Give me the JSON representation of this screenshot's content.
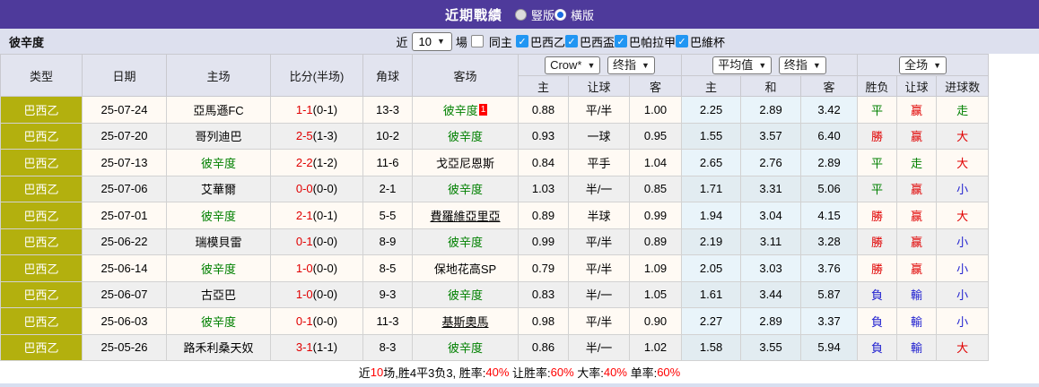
{
  "colors": {
    "accent_purple": "#4e3a9b",
    "league_bg": "#b3b00e",
    "checkbox_blue": "#2196f3",
    "red": "#e00000",
    "green": "#008000",
    "blue": "#2222d0"
  },
  "topbar": {
    "title": "近期戰績",
    "radios": [
      {
        "label": "豎版",
        "selected": false
      },
      {
        "label": "橫版",
        "selected": true
      }
    ]
  },
  "filterbar": {
    "team": "彼辛度",
    "near_label": "近",
    "matches_value": "10",
    "matches_unit": "場",
    "same_home": {
      "label": "同主",
      "checked": false
    },
    "leagues": [
      {
        "label": "巴西乙",
        "checked": true
      },
      {
        "label": "巴西盃",
        "checked": true
      },
      {
        "label": "巴帕拉甲",
        "checked": true
      },
      {
        "label": "巴維杯",
        "checked": true
      }
    ]
  },
  "table": {
    "static_headers": [
      "类型",
      "日期",
      "主场",
      "比分(半场)",
      "角球",
      "客场"
    ],
    "group1": {
      "select1": "Crow*",
      "select2": "终指",
      "cols": [
        "主",
        "让球",
        "客"
      ]
    },
    "group2": {
      "select1": "平均值",
      "select2": "终指",
      "cols": [
        "主",
        "和",
        "客"
      ]
    },
    "group3": {
      "select": "全场",
      "cols": [
        "胜负",
        "让球",
        "进球数"
      ]
    },
    "rows": [
      {
        "league": "巴西乙",
        "date": "25-07-24",
        "home": {
          "name": "亞馬遜FC",
          "green": false,
          "underline": false
        },
        "score": {
          "ft": "1-1",
          "ht": "(0-1)"
        },
        "corner": "13-3",
        "away": {
          "name": "彼辛度",
          "green": true,
          "underline": false,
          "badge": "1"
        },
        "odds": [
          "0.88",
          "平/半",
          "1.00"
        ],
        "avg": [
          "2.25",
          "2.89",
          "3.42"
        ],
        "results": [
          {
            "text": "平",
            "color": "green"
          },
          {
            "text": "赢",
            "color": "red"
          },
          {
            "text": "走",
            "color": "green"
          }
        ]
      },
      {
        "league": "巴西乙",
        "date": "25-07-20",
        "home": {
          "name": "哥列迪巴",
          "green": false,
          "underline": false
        },
        "score": {
          "ft": "2-5",
          "ht": "(1-3)"
        },
        "corner": "10-2",
        "away": {
          "name": "彼辛度",
          "green": true,
          "underline": false
        },
        "odds": [
          "0.93",
          "一球",
          "0.95"
        ],
        "avg": [
          "1.55",
          "3.57",
          "6.40"
        ],
        "results": [
          {
            "text": "勝",
            "color": "red"
          },
          {
            "text": "赢",
            "color": "red"
          },
          {
            "text": "大",
            "color": "red"
          }
        ]
      },
      {
        "league": "巴西乙",
        "date": "25-07-13",
        "home": {
          "name": "彼辛度",
          "green": true,
          "underline": false
        },
        "score": {
          "ft": "2-2",
          "ht": "(1-2)"
        },
        "corner": "11-6",
        "away": {
          "name": "戈亞尼恩斯",
          "green": false,
          "underline": false
        },
        "odds": [
          "0.84",
          "平手",
          "1.04"
        ],
        "avg": [
          "2.65",
          "2.76",
          "2.89"
        ],
        "results": [
          {
            "text": "平",
            "color": "green"
          },
          {
            "text": "走",
            "color": "green"
          },
          {
            "text": "大",
            "color": "red"
          }
        ]
      },
      {
        "league": "巴西乙",
        "date": "25-07-06",
        "home": {
          "name": "艾華爾",
          "green": false,
          "underline": false
        },
        "score": {
          "ft": "0-0",
          "ht": "(0-0)"
        },
        "corner": "2-1",
        "away": {
          "name": "彼辛度",
          "green": true,
          "underline": false
        },
        "odds": [
          "1.03",
          "半/一",
          "0.85"
        ],
        "avg": [
          "1.71",
          "3.31",
          "5.06"
        ],
        "results": [
          {
            "text": "平",
            "color": "green"
          },
          {
            "text": "赢",
            "color": "red"
          },
          {
            "text": "小",
            "color": "blue"
          }
        ]
      },
      {
        "league": "巴西乙",
        "date": "25-07-01",
        "home": {
          "name": "彼辛度",
          "green": true,
          "underline": false
        },
        "score": {
          "ft": "2-1",
          "ht": "(0-1)"
        },
        "corner": "5-5",
        "away": {
          "name": "費羅維亞里亞",
          "green": false,
          "underline": true
        },
        "odds": [
          "0.89",
          "半球",
          "0.99"
        ],
        "avg": [
          "1.94",
          "3.04",
          "4.15"
        ],
        "results": [
          {
            "text": "勝",
            "color": "red"
          },
          {
            "text": "赢",
            "color": "red"
          },
          {
            "text": "大",
            "color": "red"
          }
        ]
      },
      {
        "league": "巴西乙",
        "date": "25-06-22",
        "home": {
          "name": "瑞模貝雷",
          "green": false,
          "underline": false
        },
        "score": {
          "ft": "0-1",
          "ht": "(0-0)"
        },
        "corner": "8-9",
        "away": {
          "name": "彼辛度",
          "green": true,
          "underline": false
        },
        "odds": [
          "0.99",
          "平/半",
          "0.89"
        ],
        "avg": [
          "2.19",
          "3.11",
          "3.28"
        ],
        "results": [
          {
            "text": "勝",
            "color": "red"
          },
          {
            "text": "赢",
            "color": "red"
          },
          {
            "text": "小",
            "color": "blue"
          }
        ]
      },
      {
        "league": "巴西乙",
        "date": "25-06-14",
        "home": {
          "name": "彼辛度",
          "green": true,
          "underline": false
        },
        "score": {
          "ft": "1-0",
          "ht": "(0-0)"
        },
        "corner": "8-5",
        "away": {
          "name": "保地花高SP",
          "green": false,
          "underline": false
        },
        "odds": [
          "0.79",
          "平/半",
          "1.09"
        ],
        "avg": [
          "2.05",
          "3.03",
          "3.76"
        ],
        "results": [
          {
            "text": "勝",
            "color": "red"
          },
          {
            "text": "赢",
            "color": "red"
          },
          {
            "text": "小",
            "color": "blue"
          }
        ]
      },
      {
        "league": "巴西乙",
        "date": "25-06-07",
        "home": {
          "name": "古亞巴",
          "green": false,
          "underline": false
        },
        "score": {
          "ft": "1-0",
          "ht": "(0-0)"
        },
        "corner": "9-3",
        "away": {
          "name": "彼辛度",
          "green": true,
          "underline": false
        },
        "odds": [
          "0.83",
          "半/一",
          "1.05"
        ],
        "avg": [
          "1.61",
          "3.44",
          "5.87"
        ],
        "results": [
          {
            "text": "負",
            "color": "blue"
          },
          {
            "text": "輸",
            "color": "blue"
          },
          {
            "text": "小",
            "color": "blue"
          }
        ]
      },
      {
        "league": "巴西乙",
        "date": "25-06-03",
        "home": {
          "name": "彼辛度",
          "green": true,
          "underline": false
        },
        "score": {
          "ft": "0-1",
          "ht": "(0-0)"
        },
        "corner": "11-3",
        "away": {
          "name": "基斯奧馬",
          "green": false,
          "underline": true
        },
        "odds": [
          "0.98",
          "平/半",
          "0.90"
        ],
        "avg": [
          "2.27",
          "2.89",
          "3.37"
        ],
        "results": [
          {
            "text": "負",
            "color": "blue"
          },
          {
            "text": "輸",
            "color": "blue"
          },
          {
            "text": "小",
            "color": "blue"
          }
        ]
      },
      {
        "league": "巴西乙",
        "date": "25-05-26",
        "home": {
          "name": "路禾利桑天奴",
          "green": false,
          "underline": false
        },
        "score": {
          "ft": "3-1",
          "ht": "(1-1)"
        },
        "corner": "8-3",
        "away": {
          "name": "彼辛度",
          "green": true,
          "underline": false
        },
        "odds": [
          "0.86",
          "半/一",
          "1.02"
        ],
        "avg": [
          "1.58",
          "3.55",
          "5.94"
        ],
        "results": [
          {
            "text": "負",
            "color": "blue"
          },
          {
            "text": "輸",
            "color": "blue"
          },
          {
            "text": "大",
            "color": "red"
          }
        ]
      }
    ]
  },
  "footer": {
    "segments": [
      {
        "text": "近",
        "red": false
      },
      {
        "text": "10",
        "red": true
      },
      {
        "text": "场,胜4平3负3, 胜率:",
        "red": false
      },
      {
        "text": "40%",
        "red": true
      },
      {
        "text": " 让胜率:",
        "red": false
      },
      {
        "text": "60%",
        "red": true
      },
      {
        "text": " 大率:",
        "red": false
      },
      {
        "text": "40%",
        "red": true
      },
      {
        "text": " 单率:",
        "red": false
      },
      {
        "text": "60%",
        "red": true
      }
    ]
  }
}
